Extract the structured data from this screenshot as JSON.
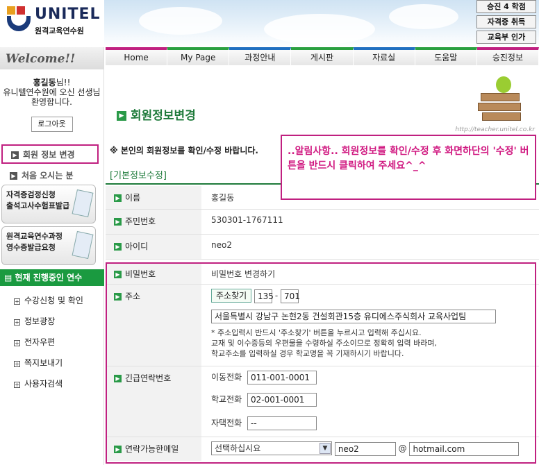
{
  "header": {
    "logo_title": "UNITEL",
    "logo_subtitle": "원격교육연수원",
    "badges": [
      "승진 4 학점",
      "자격증 취득",
      "교육부 인가"
    ]
  },
  "nav": {
    "items": [
      "Home",
      "My Page",
      "과정안내",
      "게시판",
      "자료실",
      "도움말",
      "승진정보"
    ]
  },
  "sidebar": {
    "welcome": "Welcome!!",
    "user_name": "홍길동",
    "greeting_suffix": "님!!",
    "greeting_rest": "유니텔연수원에 오신 선생님 환영합니다.",
    "logout": "로그아웃",
    "member_info": "회원 정보 변경",
    "first_visit": "처음 오시는 분",
    "promo1_line1": "자격증검정신청",
    "promo1_line2": "출석고사수험표발급",
    "promo2_line1": "원격교육연수과정",
    "promo2_line2": "영수증발급요청",
    "current_title": "현재 진행중인 연수",
    "courses": [
      "수강신청 및 확인",
      "정보광장",
      "전자우편",
      "쪽지보내기",
      "사용자검색"
    ]
  },
  "main": {
    "page_title": "회원정보변경",
    "url_text": "http://teacher.unitel.co.kr",
    "notice": "※ 본인의 회원정보를 확인/수정 바랍니다.",
    "section": "[기본정보수정]",
    "popup": "..알림사항.. 회원정보를 확인/수정 후 화면하단의 '수정' 버튼을 반드시 클릭하여 주세요^_^",
    "fields": {
      "name_label": "이름",
      "name_value": "홍길동",
      "ssn_label": "주민번호",
      "ssn_value": "530301-1767111",
      "id_label": "아이디",
      "id_value": "neo2",
      "pw_label": "비밀번호",
      "pw_value": "비밀번호 변경하기",
      "addr_label": "주소",
      "addr_button": "주소찾기",
      "zip1": "135",
      "zip2": "701",
      "addr_value": "서울특별시 강남구 논현2동 건설회관15층 유디에스주식회사 교육사업팀",
      "addr_note1": "* 주소입력시 반드시 '주소찾기' 버튼을 누르시고 입력해 주십시요.",
      "addr_note2": "교재 및 이수증등의 우편물을 수령하실 주소이므로 정확히 입력 바라며,",
      "addr_note3": "학교주소를 입력하실 경우 학교명을 꼭 기재하시기 바랍니다.",
      "emergency_label": "긴급연락번호",
      "mobile_label": "이동전화",
      "mobile_value": "011-001-0001",
      "school_label": "학교전화",
      "school_value": "02-001-0001",
      "home_label": "자택전화",
      "home_value": "--",
      "email_label": "연락가능한메일",
      "email_select": "선택하십시요",
      "email_id": "neo2",
      "email_at": "@",
      "email_domain": "hotmail.com"
    }
  }
}
